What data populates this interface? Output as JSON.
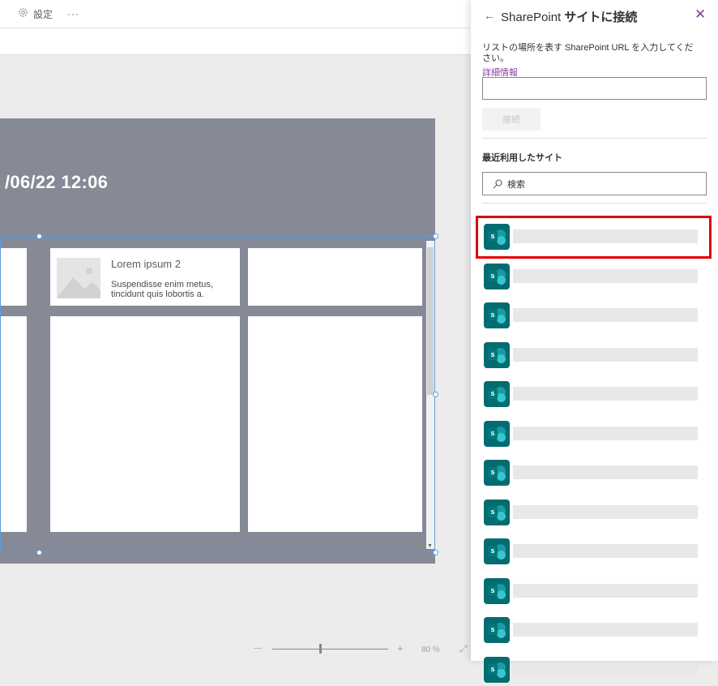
{
  "toolbar": {
    "settings_label": "設定",
    "more_label": "···"
  },
  "canvas": {
    "header_text": "/06/22 12:06",
    "tile_title": "Lorem ipsum 2",
    "tile_subtitle": "Suspendisse enim metus, tincidunt quis lobortis a."
  },
  "statusbar": {
    "minus": "—",
    "plus": "+",
    "zoom": "80 %",
    "expand": "⤢"
  },
  "panel": {
    "back": "←",
    "title_prefix": "SharePoint",
    "title_suffix": "サイトに接続",
    "close": "✕",
    "description": "リストの場所を表す SharePoint URL を入力してください。",
    "more_info": "詳細情報",
    "url_value": "",
    "connect_label": "接続",
    "recent_label": "最近利用したサイト",
    "search_placeholder": "検索",
    "site_icon_letter": "s"
  },
  "sites": [
    {
      "name": ""
    },
    {
      "name": ""
    },
    {
      "name": ""
    },
    {
      "name": ""
    },
    {
      "name": ""
    },
    {
      "name": ""
    },
    {
      "name": ""
    },
    {
      "name": ""
    },
    {
      "name": ""
    },
    {
      "name": ""
    },
    {
      "name": ""
    },
    {
      "name": ""
    }
  ],
  "colors": {
    "accent": "#8a3ea0",
    "sharepoint": "#036c70",
    "highlight": "#e00000",
    "canvas_bg": "#858a96"
  }
}
